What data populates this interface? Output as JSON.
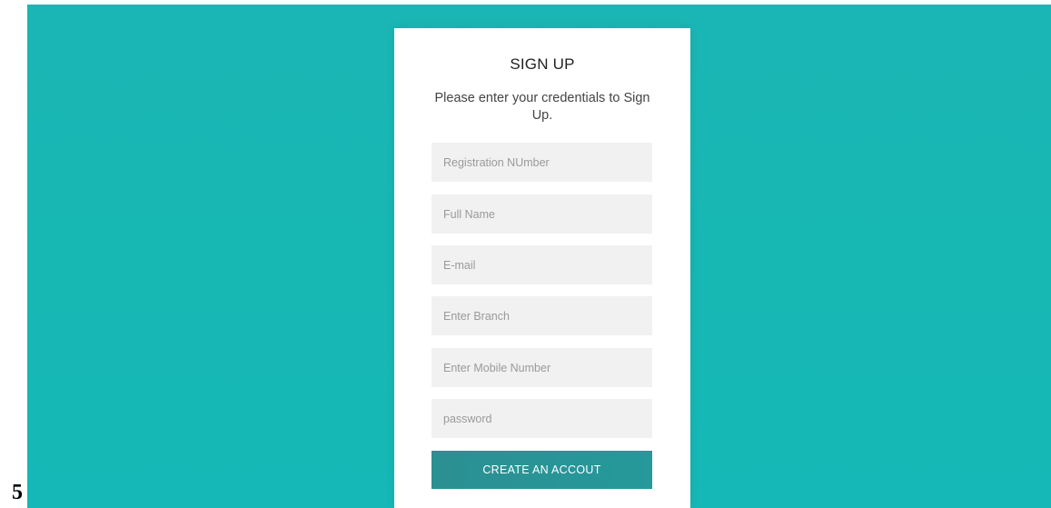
{
  "side_label": "5",
  "form": {
    "title": "SIGN UP",
    "subtitle": "Please enter your credentials to Sign Up.",
    "fields": [
      {
        "placeholder": "Registration NUmber",
        "value": ""
      },
      {
        "placeholder": "Full Name",
        "value": ""
      },
      {
        "placeholder": "E-mail",
        "value": ""
      },
      {
        "placeholder": "Enter Branch",
        "value": ""
      },
      {
        "placeholder": "Enter Mobile Number",
        "value": ""
      },
      {
        "placeholder": "password",
        "value": ""
      }
    ],
    "submit_label": "CREATE AN ACCOUT"
  },
  "colors": {
    "background": "#17b7b4",
    "card": "#ffffff",
    "input_bg": "#f1f1f1",
    "button": "#2a9395"
  }
}
